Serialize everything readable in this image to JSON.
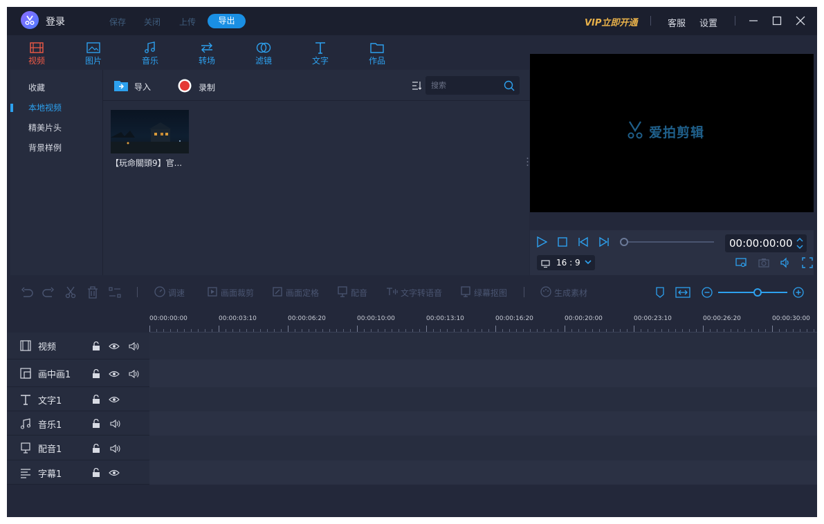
{
  "titlebar": {
    "login_label": "登录",
    "menu": [
      "保存",
      "关闭",
      "上传"
    ],
    "export_label": "导出",
    "vip_label": "VIP立即开通",
    "service_label": "客服",
    "settings_label": "设置"
  },
  "tabs": [
    {
      "label": "视频",
      "icon": "film-icon",
      "active": true
    },
    {
      "label": "图片",
      "icon": "image-icon"
    },
    {
      "label": "音乐",
      "icon": "music-icon"
    },
    {
      "label": "转场",
      "icon": "transition-icon"
    },
    {
      "label": "滤镜",
      "icon": "filter-icon"
    },
    {
      "label": "文字",
      "icon": "text-icon"
    },
    {
      "label": "作品",
      "icon": "folder-icon"
    }
  ],
  "leftnav": {
    "items": [
      "收藏",
      "本地视频",
      "精美片头",
      "背景样例"
    ],
    "active_index": 1
  },
  "media": {
    "import_label": "导入",
    "record_label": "录制",
    "search_placeholder": "搜索",
    "items": [
      {
        "caption": "【玩命關頭9】官..."
      }
    ]
  },
  "preview": {
    "brand": "爱拍剪辑",
    "timecode": "00:00:00:00",
    "ratio": "16 : 9"
  },
  "edit_toolbar": {
    "tools": [
      "调速",
      "画面裁剪",
      "画面定格",
      "配音",
      "文字转语音",
      "绿幕抠图",
      "生成素材"
    ]
  },
  "ruler": {
    "labels": [
      "00:00:00:00",
      "00:00:03:10",
      "00:00:06:20",
      "00:00:10:00",
      "00:00:13:10",
      "00:00:16:20",
      "00:00:20:00",
      "00:00:23:10",
      "00:00:26:20",
      "00:00:30:00"
    ]
  },
  "tracks": [
    {
      "name": "视频",
      "icon": "film-icon"
    },
    {
      "name": "画中画1",
      "icon": "pip-icon"
    },
    {
      "name": "文字1",
      "icon": "text-icon"
    },
    {
      "name": "音乐1",
      "icon": "music-icon"
    },
    {
      "name": "配音1",
      "icon": "dubbing-icon"
    },
    {
      "name": "字幕1",
      "icon": "subtitle-icon"
    }
  ],
  "colors": {
    "accent": "#2da1ef",
    "active_tab": "#f05a46",
    "vip": "#e8b14a",
    "record": "#e53935"
  }
}
